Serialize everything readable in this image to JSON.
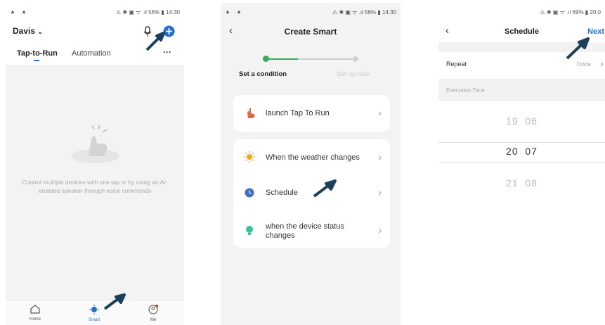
{
  "screen1": {
    "status_left": "▲ ▲",
    "status_right": "⚠ ✱ ▣ ᯤ .ıl 56% ▮ 14:30",
    "home_name": "Davis",
    "tabs": [
      "Tap-to-Run",
      "Automation"
    ],
    "more": "···",
    "empty_text": "Control multiple devices with one tap or by using an AI-enabled speaker through voice commands",
    "nav": [
      "Home",
      "Smart",
      "Me"
    ]
  },
  "screen2": {
    "status_left": "▲ ▲",
    "status_right": "⚠ ✱ ▣ ᯤ .ıl 56% ▮ 14:30",
    "title": "Create Smart",
    "steps": [
      "Set a condition",
      "Set up task"
    ],
    "launch_label": "launch Tap To Run",
    "conditions": [
      "When the weather changes",
      "Schedule",
      "when the device status changes"
    ]
  },
  "screen3": {
    "status_right": "⚠ ✱ ▣ ᯤ .ıl 69% ▮ 20:0",
    "title": "Schedule",
    "next": "Next",
    "repeat_label": "Repeat",
    "repeat_value": "Once",
    "exec_label": "Execution Time",
    "times": [
      {
        "h": "19",
        "m": "06"
      },
      {
        "h": "20",
        "m": "07"
      },
      {
        "h": "21",
        "m": "08"
      }
    ]
  },
  "colors": {
    "accent_blue": "#1f6fd6",
    "active_green": "#3aaa5a",
    "arrow": "#1c3f5c"
  }
}
